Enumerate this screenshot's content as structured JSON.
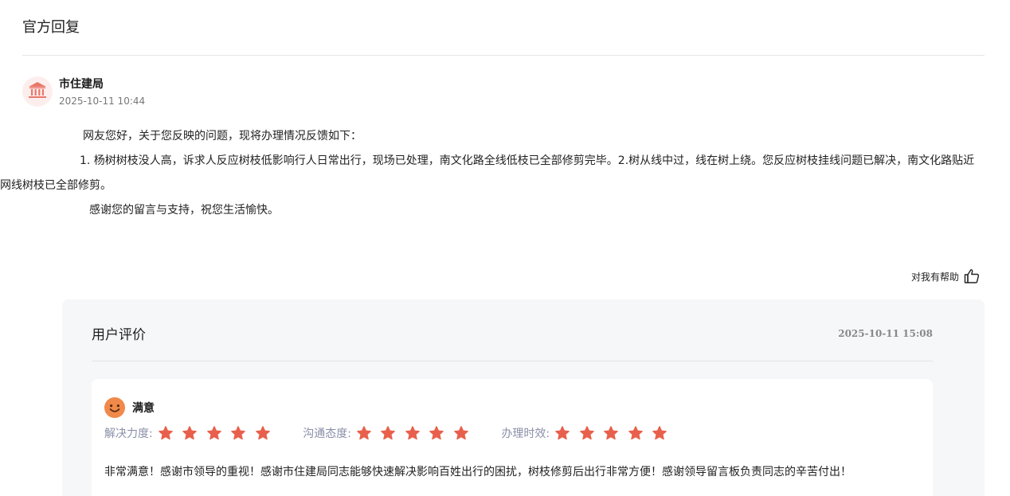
{
  "section": {
    "title": "官方回复"
  },
  "reply": {
    "department": "市住建局",
    "avatar_icon": "government-building-icon",
    "time": "2025-10-11 10:44",
    "paragraphs": [
      "网友您好，关于您反映的问题，现将办理情况反馈如下：",
      "1. 杨树树枝没人高，诉求人反应树枝低影响行人日常出行，现场已处理，南文化路全线低枝已全部修剪完毕。2.树从线中过，线在树上绕。您反应树枝挂线问题已解决，南文化路贴近网线树枝已全部修剪。",
      "感谢您的留言与支持，祝您生活愉快。"
    ]
  },
  "helpful": {
    "label": "对我有帮助",
    "icon": "thumbs-up-icon"
  },
  "evaluation": {
    "title": "用户评价",
    "time": "2025-10-11 15:08",
    "satisfaction": {
      "icon": "smiley-face-icon",
      "label": "满意"
    },
    "ratings": [
      {
        "label": "解决力度:",
        "stars": 5,
        "max": 5
      },
      {
        "label": "沟通态度:",
        "stars": 5,
        "max": 5
      },
      {
        "label": "办理时效:",
        "stars": 5,
        "max": 5
      }
    ],
    "comment": "非常满意！感谢市领导的重视！感谢市住建局同志能够快速解决影响百姓出行的困扰，树枝修剪后出行非常方便！感谢领导留言板负责同志的辛苦付出！"
  },
  "colors": {
    "accent_star": "#e8604c",
    "avatar_bg": "#fdeeee",
    "panel_bg": "#f6f7f9"
  }
}
